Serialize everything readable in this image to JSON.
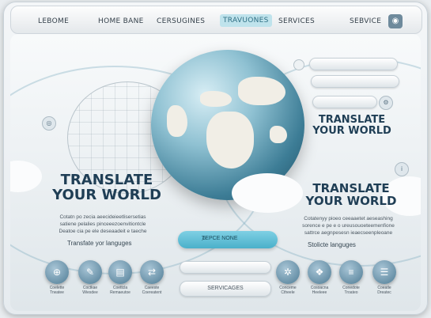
{
  "nav": {
    "items": [
      "LEBOME",
      "HOME BANE",
      "CERSUGINES",
      "TRAVUONES",
      "SERVICES",
      "SEBVICE"
    ],
    "active_index": 3
  },
  "hero_left": {
    "title_line1": "TRANSLATE",
    "title_line2": "YOUR WORLD",
    "body_line1": "Cotatn po zecia aeecideieetlisersetias",
    "body_line2": "satiene pelalies pinceeezoenvitiontcle",
    "body_line3": "Deatoe cia pe ele deseaadeit e taeche",
    "subtitle": "Transfate yor languges"
  },
  "hero_right_small": {
    "title_line1": "TRANSLATE",
    "title_line2": "YOUR WORLD"
  },
  "hero_right": {
    "title_line1": "TRANSLATE",
    "title_line2": "YOUR WORLD",
    "body_line1": "Cotatenyy pioeo ceeaaetet aeseashing",
    "body_line2": "sorence e pe e o ureusouoeteemenfione",
    "body_line3": "sattrce aegnpesesn ieaecseenpleoane",
    "subtitle": "Stolicte languges"
  },
  "search": {
    "label": "TEPCE NONE",
    "icon": "search-icon"
  },
  "bars": {
    "bottom_label": "SERVICAGES"
  },
  "right_pills": [
    "",
    "",
    ""
  ],
  "left_icons": [
    {
      "icon": "globe-icon",
      "label": "Coelette\nTrwatee"
    },
    {
      "icon": "chat-icon",
      "label": "Coctkae\nWiesdee"
    },
    {
      "icon": "document-icon",
      "label": "Coettcla\nRemaeutoe"
    },
    {
      "icon": "translate-icon",
      "label": "Caeeste\nCoereatent"
    }
  ],
  "right_icons": [
    {
      "icon": "share-icon",
      "label": "Conceme\nCtheele"
    },
    {
      "icon": "network-icon",
      "label": "Cosoacna\nHeeleee"
    },
    {
      "icon": "list-icon",
      "label": "Conedote\nTroateo"
    },
    {
      "icon": "menu-icon",
      "label": "Coeatle\nDreatec"
    }
  ],
  "colors": {
    "accent": "#4ab0ca",
    "title": "#1f3e55",
    "globe": "#3d7d96"
  }
}
